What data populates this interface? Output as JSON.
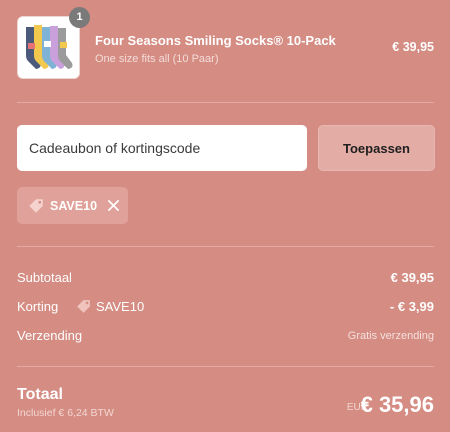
{
  "cart": {
    "items": [
      {
        "quantity": "1",
        "title": "Four Seasons Smiling Socks® 10-Pack",
        "variant": "One size fits all (10 Paar)",
        "price": "€ 39,95",
        "image_icon": "socks-product-image"
      }
    ]
  },
  "discount": {
    "placeholder": "Cadeaubon of kortingscode",
    "value": "",
    "apply_label": "Toepassen",
    "applied_code": "SAVE10",
    "tag_icon": "tag-icon",
    "remove_icon": "close-icon"
  },
  "summary": {
    "subtotal_label": "Subtotaal",
    "subtotal_value": "€ 39,95",
    "discount_label": "Korting",
    "discount_code": "SAVE10",
    "discount_value": "- € 3,99",
    "shipping_label": "Verzending",
    "shipping_value": "Gratis verzending",
    "total_label": "Totaal",
    "tax_note": "Inclusief € 6,24 BTW",
    "currency": "EUR",
    "total_value": "€ 35,96"
  },
  "colors": {
    "background": "#d48c83",
    "badge": "#7a7a7a",
    "button": "#e3aca5",
    "chip": "#dfa199"
  }
}
